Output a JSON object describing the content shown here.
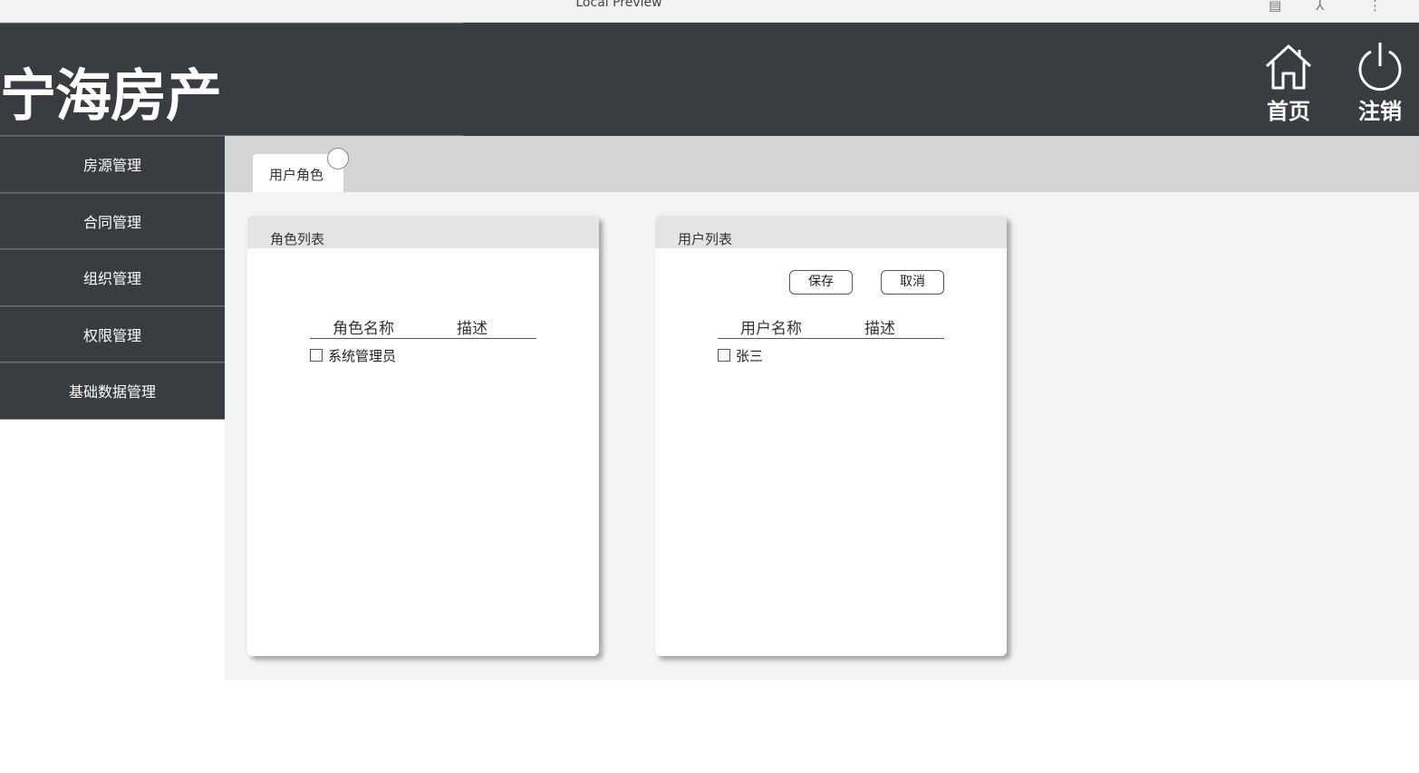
{
  "browser": {
    "title": "Local Preview"
  },
  "header": {
    "brand": "宁海房产",
    "home_label": "首页",
    "logout_label": "注销"
  },
  "sidebar": {
    "items": [
      {
        "label": "房源管理"
      },
      {
        "label": "合同管理"
      },
      {
        "label": "组织管理"
      },
      {
        "label": "权限管理"
      },
      {
        "label": "基础数据管理"
      }
    ]
  },
  "tabs": [
    {
      "label": "用户角色"
    }
  ],
  "role_panel": {
    "title": "角色列表",
    "columns": [
      "角色名称",
      "描述"
    ],
    "rows": [
      {
        "name": "系统管理员",
        "desc": ""
      }
    ]
  },
  "user_panel": {
    "title": "用户列表",
    "save_label": "保存",
    "cancel_label": "取消",
    "columns": [
      "用户名称",
      "描述"
    ],
    "rows": [
      {
        "name": "张三",
        "desc": ""
      }
    ]
  },
  "colors": {
    "header_bg": "#393d42",
    "tabbar_bg": "#d4d4d4",
    "main_bg": "#f4f4f4",
    "panel_head_bg": "#e4e4e4"
  },
  "icons": [
    "document-icon",
    "reader-icon",
    "more-icon",
    "home-icon",
    "power-icon",
    "close-circle-icon"
  ]
}
